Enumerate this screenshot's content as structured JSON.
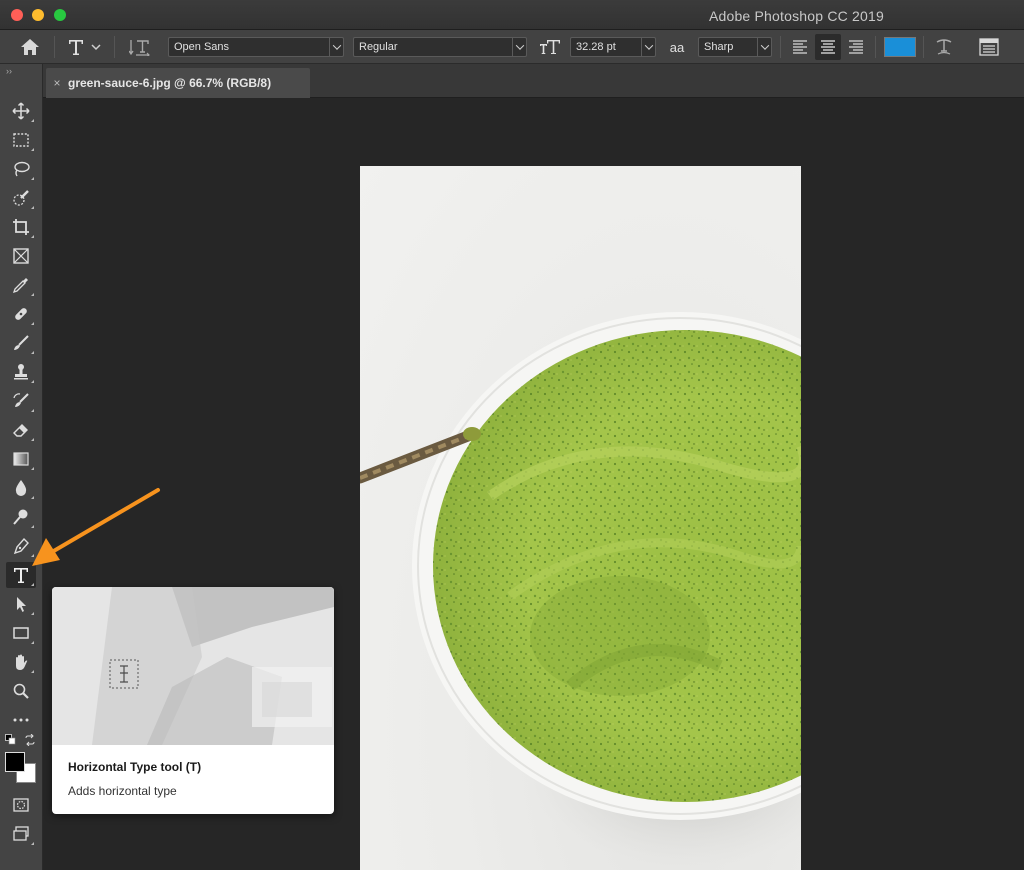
{
  "window": {
    "title": "Adobe Photoshop CC 2019"
  },
  "options_bar": {
    "font_family": "Open Sans",
    "font_style": "Regular",
    "font_size": "32.28 pt",
    "anti_alias_symbol": "aa",
    "anti_alias": "Sharp",
    "text_color": "#1a8fd8"
  },
  "document_tab": {
    "close_symbol": "×",
    "label": "green-sauce-6.jpg @ 66.7% (RGB/8)"
  },
  "toolbar": {
    "collapse_symbol": "››",
    "tools": [
      {
        "name": "move-tool",
        "icon": "move-icon"
      },
      {
        "name": "marquee-tool",
        "icon": "marquee-icon"
      },
      {
        "name": "lasso-tool",
        "icon": "lasso-icon"
      },
      {
        "name": "quick-selection-tool",
        "icon": "quick-selection-icon"
      },
      {
        "name": "crop-tool",
        "icon": "crop-icon"
      },
      {
        "name": "frame-tool",
        "icon": "frame-icon"
      },
      {
        "name": "eyedropper-tool",
        "icon": "eyedropper-icon"
      },
      {
        "name": "healing-brush-tool",
        "icon": "bandage-icon"
      },
      {
        "name": "brush-tool",
        "icon": "brush-icon"
      },
      {
        "name": "clone-stamp-tool",
        "icon": "stamp-icon"
      },
      {
        "name": "history-brush-tool",
        "icon": "history-brush-icon"
      },
      {
        "name": "eraser-tool",
        "icon": "eraser-icon"
      },
      {
        "name": "gradient-tool",
        "icon": "gradient-icon"
      },
      {
        "name": "blur-tool",
        "icon": "drop-icon"
      },
      {
        "name": "dodge-tool",
        "icon": "dodge-icon"
      },
      {
        "name": "pen-tool",
        "icon": "pen-icon"
      },
      {
        "name": "type-tool",
        "icon": "type-icon",
        "active": true
      },
      {
        "name": "path-selection-tool",
        "icon": "arrow-icon"
      },
      {
        "name": "rectangle-tool",
        "icon": "rectangle-icon"
      },
      {
        "name": "hand-tool",
        "icon": "hand-icon"
      },
      {
        "name": "zoom-tool",
        "icon": "zoom-icon"
      },
      {
        "name": "more-tools",
        "icon": "ellipsis-icon"
      }
    ],
    "foreground_color": "#000000",
    "background_color": "#ffffff"
  },
  "tooltip": {
    "title": "Horizontal Type tool (T)",
    "description": "Adds horizontal type"
  },
  "annotation": {
    "arrow_color": "#f7931e"
  }
}
